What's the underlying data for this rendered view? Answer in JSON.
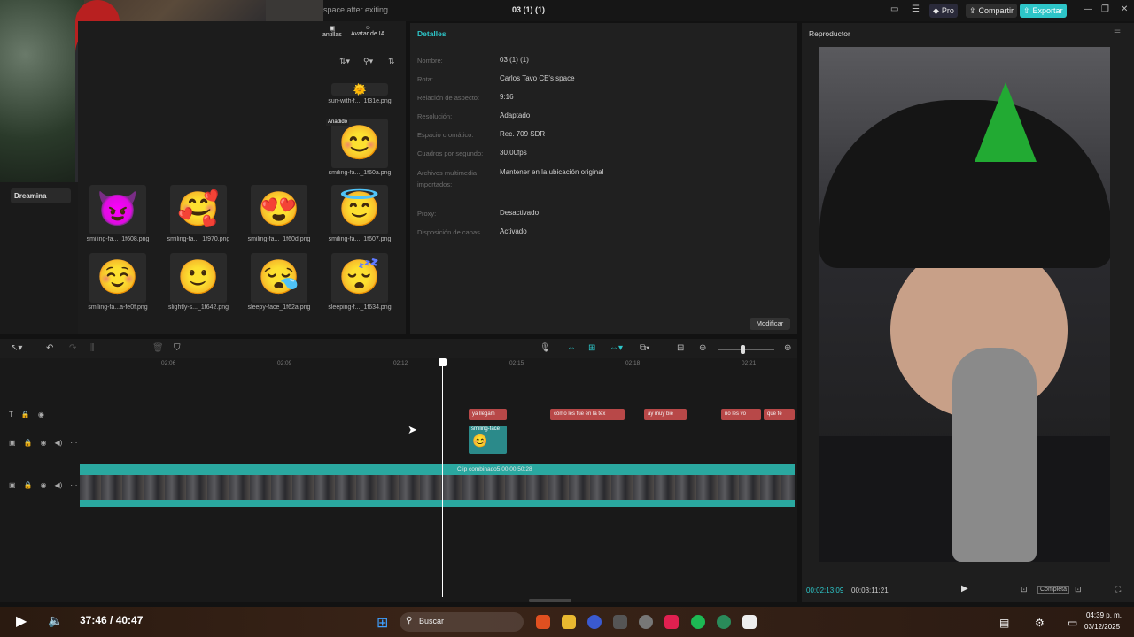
{
  "topbar": {
    "title_fragment": "space after exiting",
    "project_name": "03 (1) (1)",
    "pro_label": "Pro",
    "share_label": "Compartir",
    "export_label": "Exportar"
  },
  "sidebar": {
    "dreamina_label": "Dreamina"
  },
  "media": {
    "tabs": [
      {
        "label": "antillas"
      },
      {
        "label": "Avatar de IA"
      }
    ],
    "items": [
      {
        "caption": "sun-with-f..._1f31e.png",
        "emoji": "🌞"
      },
      {
        "caption": "smiling-fa..._1f60a.png",
        "emoji": "😊",
        "badge": "Añadido"
      },
      {
        "caption": "smiling-fa..._1f608.png",
        "emoji": "😈"
      },
      {
        "caption": "smiling-fa..._1f970.png",
        "emoji": "🥰"
      },
      {
        "caption": "smiling-fa..._1f60d.png",
        "emoji": "😍"
      },
      {
        "caption": "smiling-fa..._1f607.png",
        "emoji": "😇"
      },
      {
        "caption": "smiling-fa...a-fe0f.png",
        "emoji": "☺️"
      },
      {
        "caption": "slightly-s..._1f642.png",
        "emoji": "🙂"
      },
      {
        "caption": "sleepy-face_1f62a.png",
        "emoji": "😪"
      },
      {
        "caption": "sleeping-f..._1f634.png",
        "emoji": "😴"
      }
    ]
  },
  "details": {
    "header": "Detalles",
    "rows": [
      {
        "label": "Nombre:",
        "value": "03 (1) (1)"
      },
      {
        "label": "Rota:",
        "value": "Carlos Tavo CE's space"
      },
      {
        "label": "Relación de aspecto:",
        "value": "9:16"
      },
      {
        "label": "Resolución:",
        "value": "Adaptado"
      },
      {
        "label": "Espacio cromático:",
        "value": "Rec. 709 SDR"
      },
      {
        "label": "Cuadros por segundo:",
        "value": "30.00fps"
      },
      {
        "label": "Archivos multimedia",
        "value": "Mantener en la ubicación original"
      },
      {
        "label": "importados:",
        "value": ""
      },
      {
        "label": "Proxy:",
        "value": "Desactivado"
      },
      {
        "label": "Disposición de capas",
        "value": "Activado"
      }
    ],
    "modify_label": "Modificar"
  },
  "player": {
    "header": "Reproductor",
    "current_time": "00:02:13:09",
    "total_time": "00:03:11:21",
    "full_label": "Completa"
  },
  "timeline": {
    "ticks": [
      "02:06",
      "02:09",
      "02:12",
      "02:15",
      "02:18",
      "02:21"
    ],
    "text_clips": [
      {
        "label": "ya llegam"
      },
      {
        "label": "cómo les fue en la tex"
      },
      {
        "label": "ay muy bie"
      },
      {
        "label": "no les vo"
      },
      {
        "label": "que fe"
      }
    ],
    "sticker_clip": "smiling-face",
    "main_clip": "Clip combinado5  00:00:50:28"
  },
  "taskbar": {
    "playback": "37:46 / 40:47",
    "search_label": "Buscar",
    "clock_time": "04:39 p. m.",
    "clock_date": "03/12/2025"
  },
  "colors": {
    "accent": "#2dc5c8",
    "text_clip": "#b84848",
    "main_clip": "#2aa8a0"
  }
}
